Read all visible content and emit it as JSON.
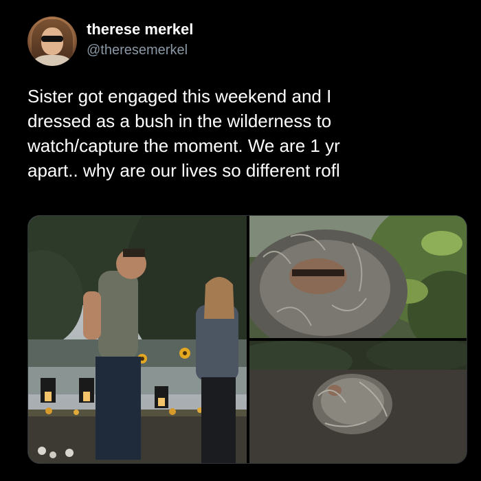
{
  "tweet": {
    "display_name": "therese merkel",
    "handle": "@theresemerkel",
    "text_lines": [
      "Sister got engaged this weekend and I",
      "dressed as a bush in the wilderness to",
      "watch/capture the moment. We are 1 yr",
      "apart.. why are our lives so different rofl"
    ]
  },
  "media": {
    "photos": [
      {
        "name": "proposal-photo"
      },
      {
        "name": "bush-costume-selfie-photo"
      },
      {
        "name": "bush-costume-ground-photo"
      }
    ]
  },
  "colors": {
    "background": "#000000",
    "text_primary": "#ffffff",
    "text_secondary": "#8b98a5",
    "border": "#2f3336"
  }
}
